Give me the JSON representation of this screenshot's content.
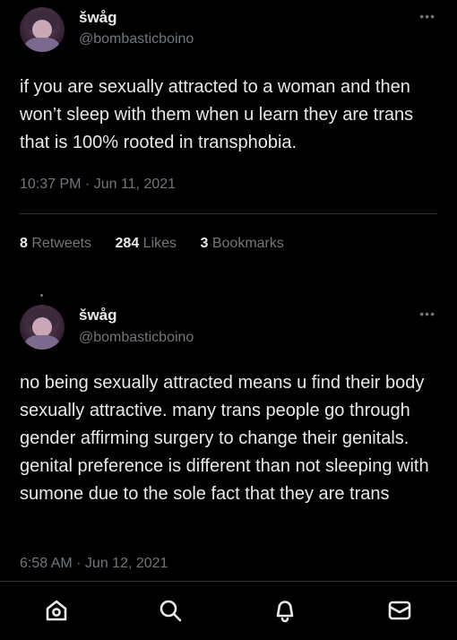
{
  "tweets": [
    {
      "name": "šwåg",
      "handle": "@bombasticboino",
      "more": "•••",
      "text": "if you are sexually attracted to a woman and then won’t sleep with them when u learn they are trans that is 100% rooted in transphobia.",
      "time": "10:37 PM · Jun 11, 2021",
      "stats": {
        "retweets_count": "8",
        "retweets_label": "Retweets",
        "likes_count": "284",
        "likes_label": "Likes",
        "bookmarks_count": "3",
        "bookmarks_label": "Bookmarks"
      }
    },
    {
      "name": "šwåg",
      "handle": "@bombasticboino",
      "more": "•••",
      "text": "no being sexually attracted means u find their body sexually attractive. many trans people go through gender affirming surgery to change their genitals. genital preference is different than not sleeping with sumone due to the sole fact that they are trans",
      "time": "6:58 AM · Jun 12, 2021"
    }
  ],
  "nav": {
    "icons": [
      "home-icon",
      "search-icon",
      "notifications-icon",
      "messages-icon"
    ]
  }
}
